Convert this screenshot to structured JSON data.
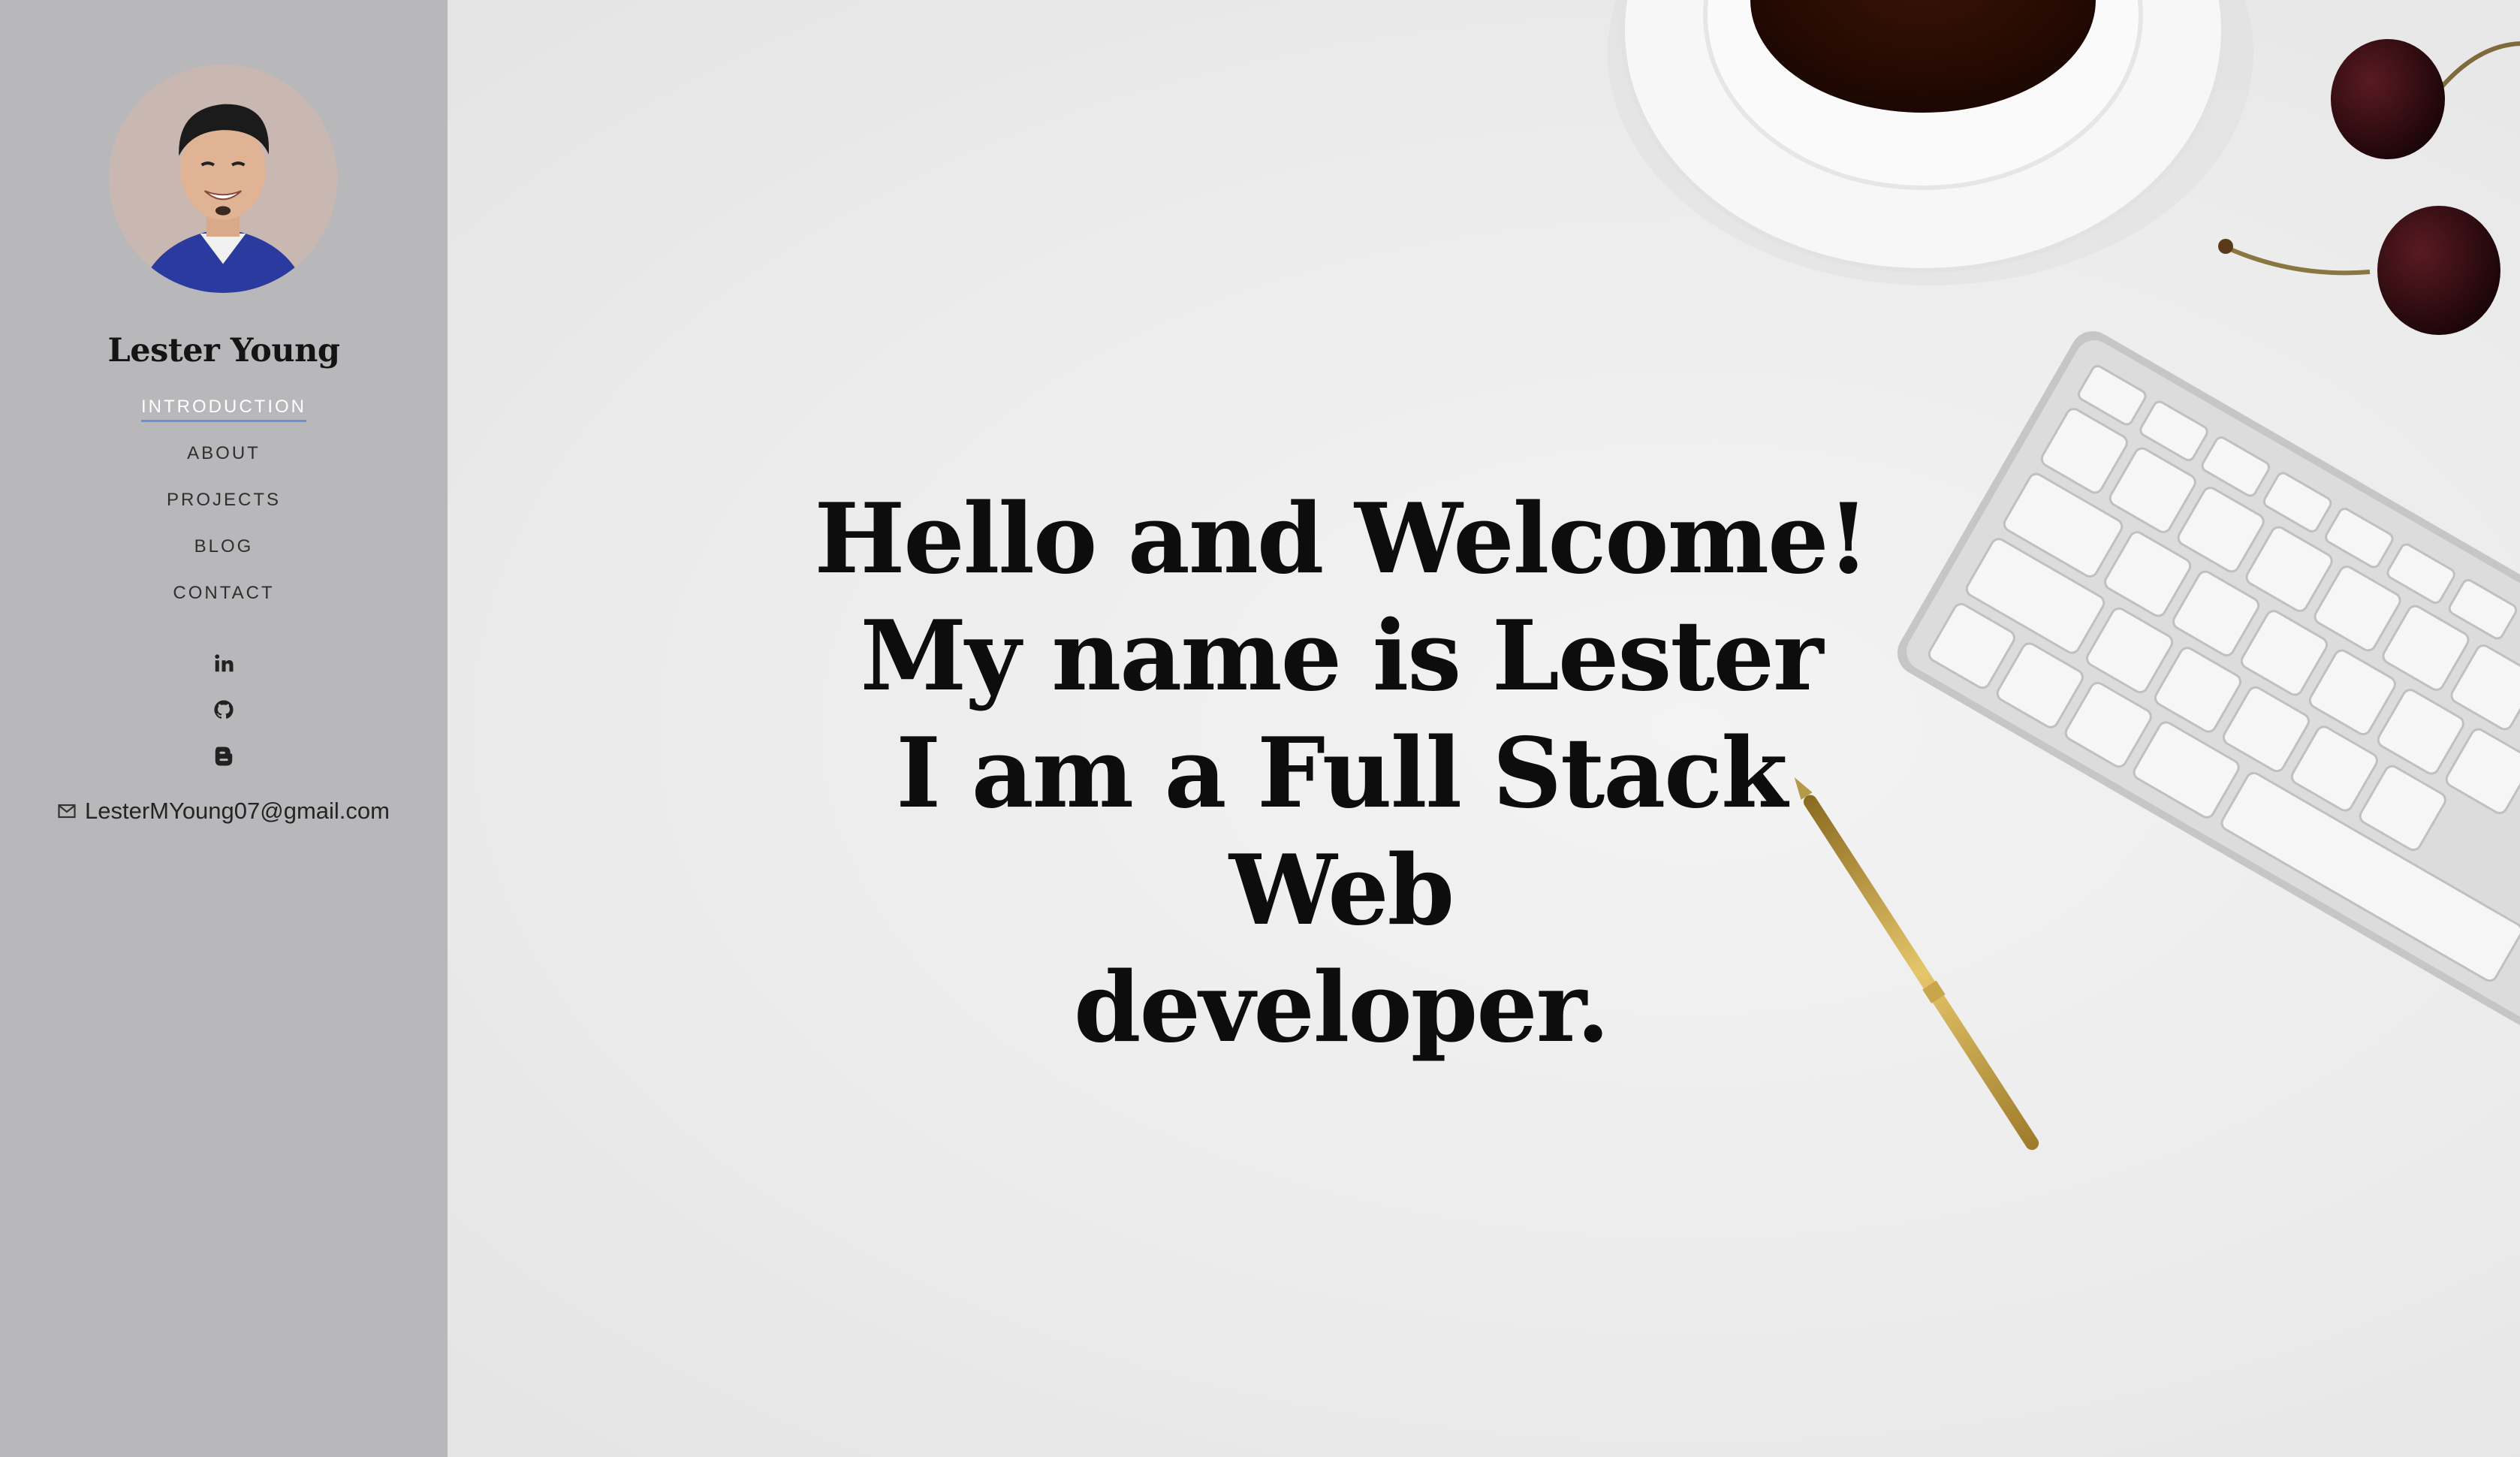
{
  "sidebar": {
    "name": "Lester Young",
    "nav": [
      {
        "label": "INTRODUCTION",
        "active": true
      },
      {
        "label": "ABOUT",
        "active": false
      },
      {
        "label": "PROJECTS",
        "active": false
      },
      {
        "label": "BLOG",
        "active": false
      },
      {
        "label": "CONTACT",
        "active": false
      }
    ],
    "social_icons": [
      "linkedin-icon",
      "github-icon",
      "blogger-icon"
    ],
    "email": "LesterMYoung07@gmail.com",
    "colors": {
      "background": "#b8b8bb",
      "active_underline": "#6e8fd3"
    }
  },
  "hero": {
    "lines": [
      "Hello and Welcome!",
      "My name is Lester",
      "I am a Full Stack Web",
      "developer."
    ]
  }
}
